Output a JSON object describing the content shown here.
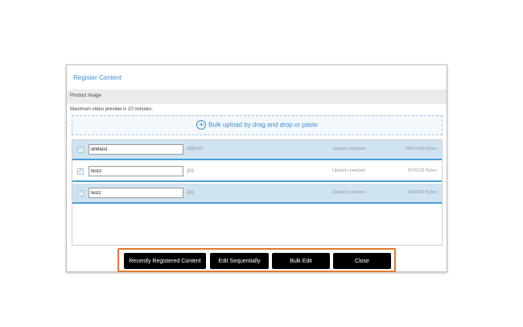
{
  "dialog": {
    "title": "Register Content",
    "section_label": "Product image",
    "note": "Maximum video preview is 10 minutes.",
    "dropzone": {
      "icon": "plus-circle-icon",
      "label": "Bulk upload by drag and drop or paste"
    }
  },
  "files": [
    {
      "name": "WMtest",
      "ext": ".afphoto",
      "status": "Upload complete",
      "size": "16431069 Bytes",
      "selected": true
    },
    {
      "name": "test3",
      "ext": ".jpg",
      "status": "Upload complete",
      "size": "6970118 Bytes",
      "selected": false
    },
    {
      "name": "test2",
      "ext": ".jpg",
      "status": "Upload complete",
      "size": "4160432 Bytes",
      "selected": true
    }
  ],
  "buttons": {
    "recently_registered": "Recently Registered Content",
    "edit_sequentially": "Edit Sequentially",
    "bulk_edit": "Bulk Edit",
    "close": "Close"
  },
  "colors": {
    "accent": "#3f8fd0",
    "row_selected": "#cfe3f1",
    "row_border": "#4a9fd8",
    "highlight_border": "#e4782d",
    "button_bg": "#000000"
  }
}
